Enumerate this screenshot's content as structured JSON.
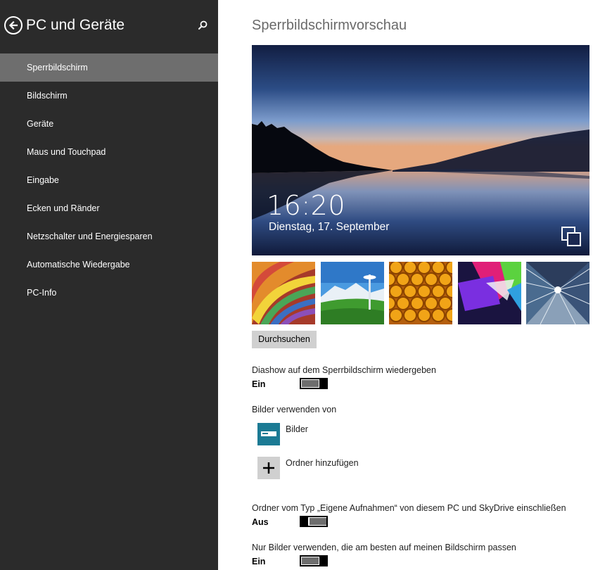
{
  "sidebar": {
    "title": "PC und Geräte",
    "items": [
      {
        "label": "Sperrbildschirm",
        "active": true
      },
      {
        "label": "Bildschirm"
      },
      {
        "label": "Geräte"
      },
      {
        "label": "Maus und Touchpad"
      },
      {
        "label": "Eingabe"
      },
      {
        "label": "Ecken und Ränder"
      },
      {
        "label": "Netzschalter und Energiesparen"
      },
      {
        "label": "Automatische Wiedergabe"
      },
      {
        "label": "PC-Info"
      }
    ]
  },
  "main": {
    "title": "Sperrbildschirmvorschau",
    "preview": {
      "time": "16:20",
      "date": "Dienstag, 17. September"
    },
    "browse_label": "Durchsuchen",
    "slideshow": {
      "label": "Diashow auf dem Sperrbildschirm wiedergeben",
      "state": "Ein"
    },
    "sources": {
      "label": "Bilder verwenden von",
      "pictures_label": "Bilder",
      "add_folder_label": "Ordner hinzufügen"
    },
    "camera_roll": {
      "label": "Ordner vom Typ „Eigene Aufnahmen“ von diesem PC und SkyDrive einschließen",
      "state": "Aus"
    },
    "best_fit": {
      "label": "Nur Bilder verwenden, die am besten auf meinen Bildschirm passen",
      "state": "Ein"
    }
  },
  "colors": {
    "sidebar_bg": "#2b2b2b",
    "sidebar_active": "#6e6e6e",
    "folder_tile": "#1b7a94",
    "add_tile": "#d0d0d0"
  }
}
